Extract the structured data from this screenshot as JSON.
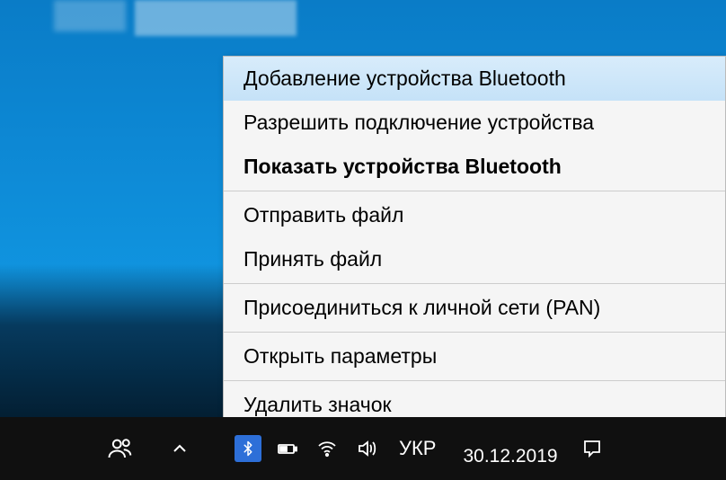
{
  "context_menu": {
    "items": [
      {
        "label": "Добавление устройства Bluetooth",
        "highlighted": true,
        "bold": false
      },
      {
        "label": "Разрешить подключение устройства",
        "highlighted": false,
        "bold": false
      },
      {
        "label": "Показать устройства Bluetooth",
        "highlighted": false,
        "bold": true
      }
    ],
    "group2": [
      {
        "label": "Отправить файл"
      },
      {
        "label": "Принять файл"
      }
    ],
    "group3": [
      {
        "label": "Присоединиться к личной сети (PAN)"
      }
    ],
    "group4": [
      {
        "label": "Открыть параметры"
      }
    ],
    "group5": [
      {
        "label": "Удалить значок"
      }
    ]
  },
  "taskbar": {
    "language": "УКР",
    "date": "30.12.2019"
  }
}
